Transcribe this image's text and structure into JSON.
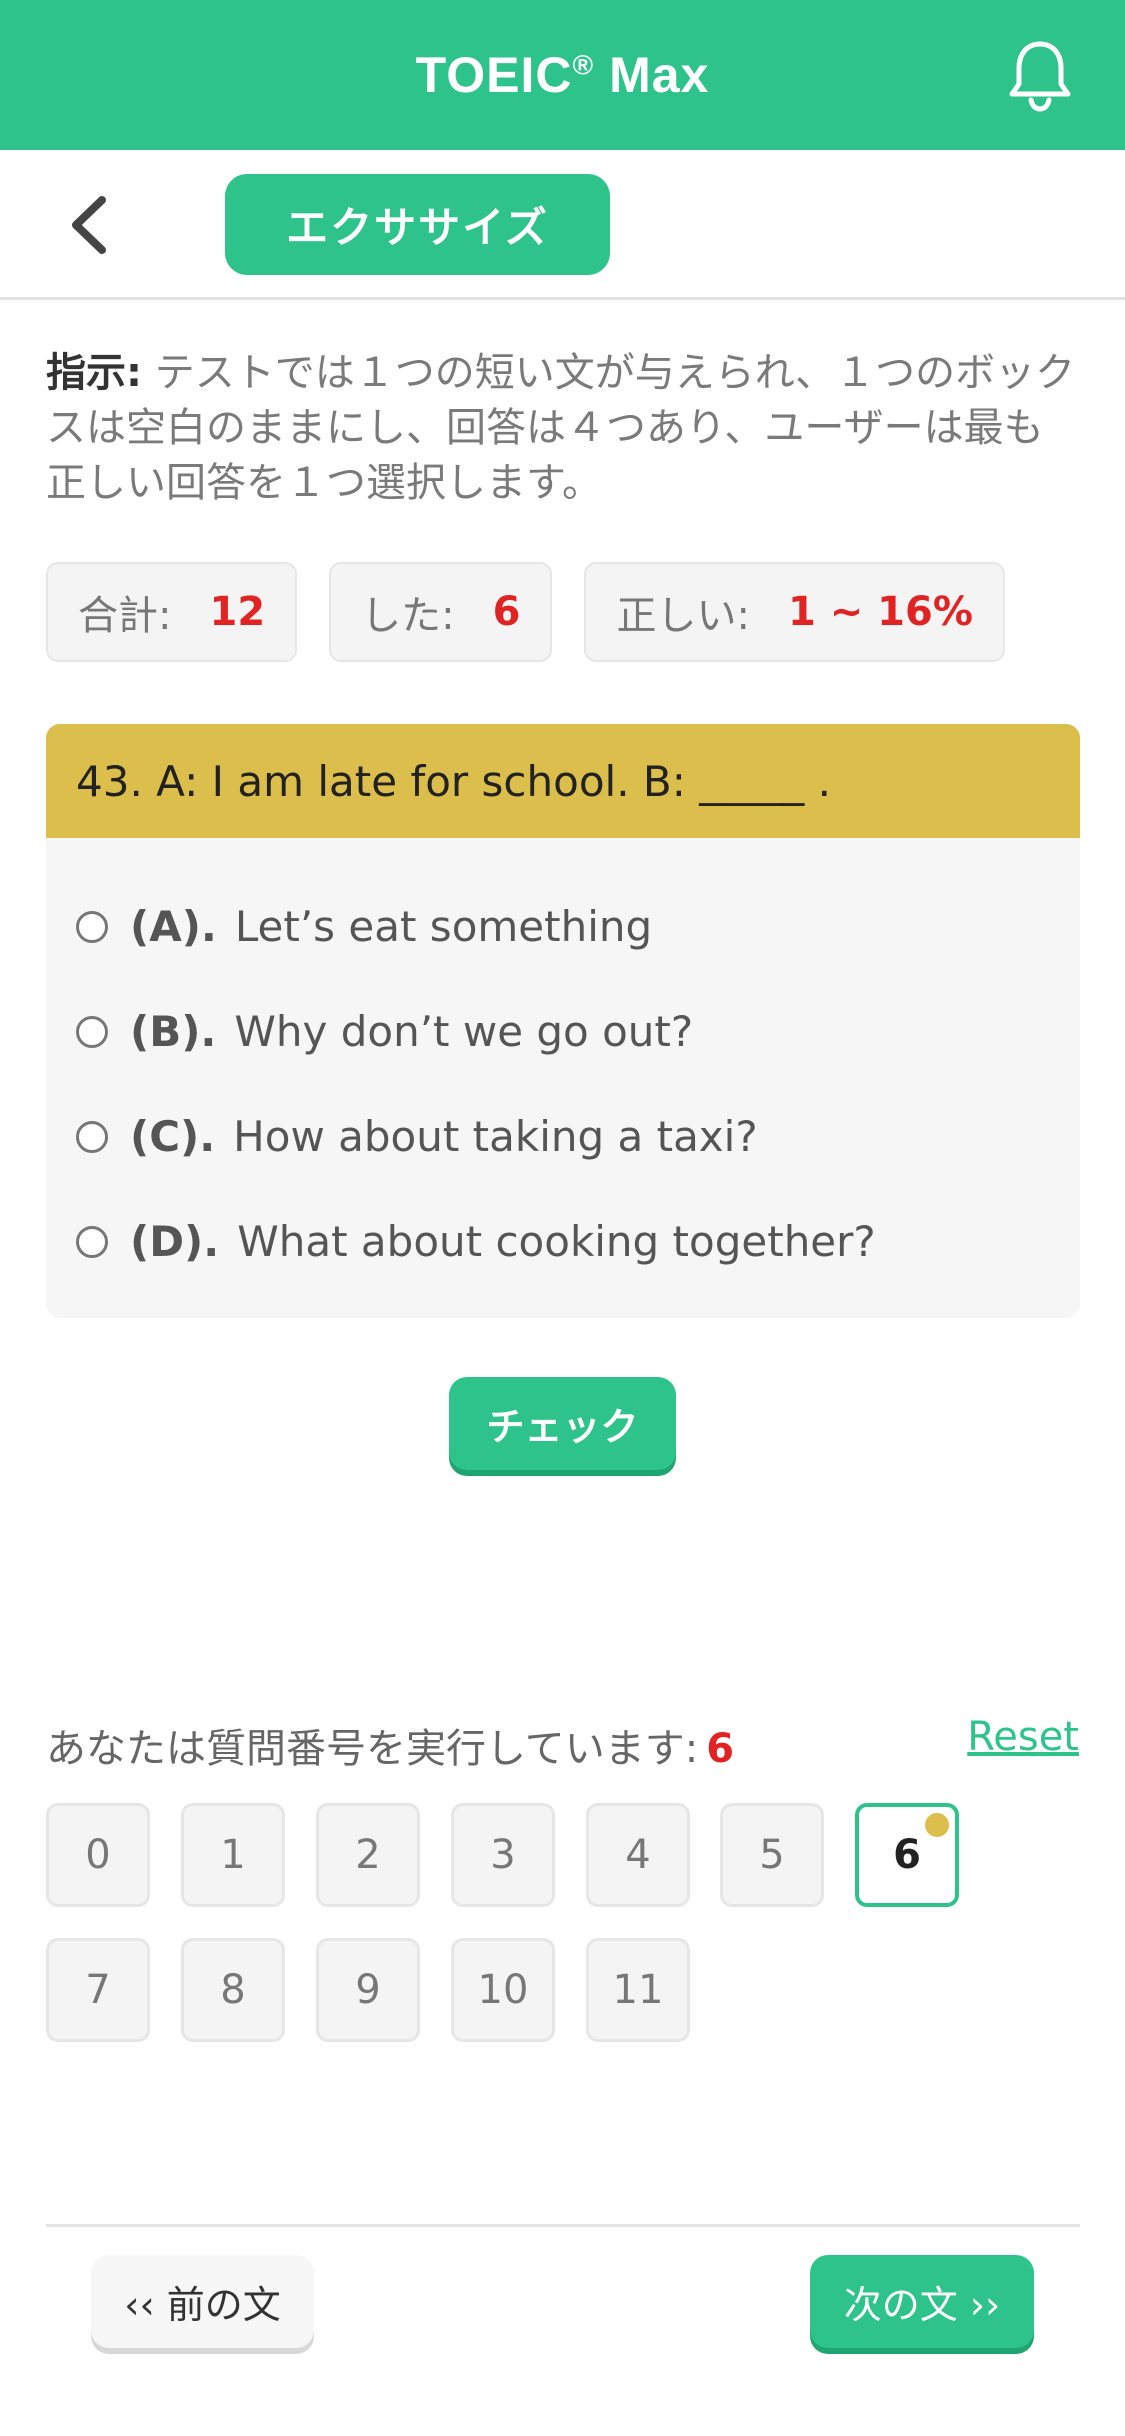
{
  "header": {
    "title": "TOEIC",
    "title_mark": "®",
    "title_suffix": " Max",
    "icon": "bell-icon"
  },
  "topbar": {
    "back_icon": "chevron-left-icon",
    "tab_label": "エクササイズ"
  },
  "instructions": {
    "lead": "指示:",
    "text": " テストでは１つの短い文が与えられ、１つのボックスは空白のままにし、回答は４つあり、ユーザーは最も正しい回答を１つ選択します。"
  },
  "stats": {
    "total_label": "合計:",
    "total_value": "12",
    "done_label": "した:",
    "done_value": "6",
    "correct_label": "正しい:",
    "correct_value": "1 ~ 16%"
  },
  "question": {
    "text": "43. A: I am late for school. B: _____ .",
    "options": [
      {
        "letter": "(A).",
        "text": "Let’s eat something"
      },
      {
        "letter": "(B).",
        "text": "Why don’t we go out?"
      },
      {
        "letter": "(C).",
        "text": "How about taking a taxi?"
      },
      {
        "letter": "(D).",
        "text": "What about cooking together?"
      }
    ]
  },
  "check_button": "チェック",
  "progress": {
    "label": "あなたは質問番号を実行しています:",
    "current": "6",
    "reset": "Reset",
    "numbers": [
      "0",
      "1",
      "2",
      "3",
      "4",
      "5",
      "6",
      "7",
      "8",
      "9",
      "10",
      "11"
    ],
    "active_index": 6
  },
  "nav": {
    "prev": "‹‹ 前の文",
    "next": "次の文 ››"
  },
  "colors": {
    "brand": "#2ec38a",
    "question_header": "#dbbe4b",
    "accent_red": "#e02424"
  }
}
